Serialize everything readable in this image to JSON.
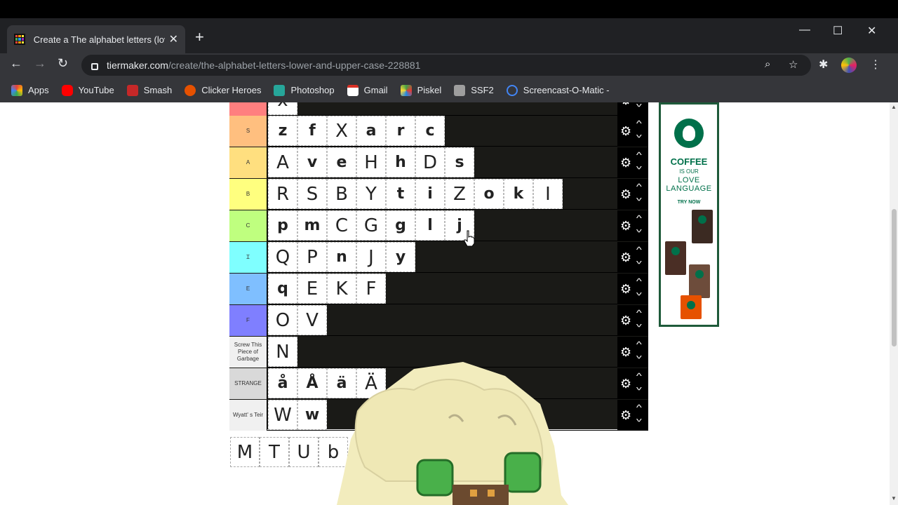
{
  "browser": {
    "tab_title": "Create a The alphabet letters (lov",
    "tab_close": "✕",
    "new_tab": "+",
    "url_host": "tiermaker.com",
    "url_path": "/create/the-alphabet-letters-lower-and-upper-case-228881",
    "window_controls": [
      "—",
      "☐",
      "✕"
    ],
    "nav": {
      "back": "←",
      "forward": "→",
      "reload": "↻"
    },
    "icons": {
      "zoom": "⌕",
      "star": "☆",
      "extensions": "✱",
      "menu": "⋮"
    }
  },
  "bookmarks": [
    {
      "label": "Apps",
      "icon": "apps-grid-icon",
      "color": "#ea4335"
    },
    {
      "label": "YouTube",
      "icon": "youtube-icon",
      "color": "#ff0000"
    },
    {
      "label": "Smash",
      "icon": "smash-icon",
      "color": "#c62828"
    },
    {
      "label": "Clicker Heroes",
      "icon": "clicker-heroes-icon",
      "color": "#e65100"
    },
    {
      "label": "Photoshop",
      "icon": "photoshop-icon",
      "color": "#26a69a"
    },
    {
      "label": "Gmail",
      "icon": "gmail-icon",
      "color": "#d93025"
    },
    {
      "label": "Piskel",
      "icon": "piskel-icon",
      "color": "#43a047"
    },
    {
      "label": "SSF2",
      "icon": "ssf2-icon",
      "color": "#9e9e9e"
    },
    {
      "label": "Screencast-O-Matic -",
      "icon": "screencast-icon",
      "color": "#4285f4"
    }
  ],
  "tiers": [
    {
      "label": "",
      "color": "#ff7f7f",
      "items": [
        "x"
      ]
    },
    {
      "label": "S",
      "color": "#ffbf7f",
      "items": [
        "z",
        "f",
        "X",
        "a",
        "r",
        "c"
      ]
    },
    {
      "label": "A",
      "color": "#ffdf7f",
      "items": [
        "A",
        "v",
        "e",
        "H",
        "h",
        "D",
        "s"
      ]
    },
    {
      "label": "B",
      "color": "#ffff7f",
      "items": [
        "R",
        "S",
        "B",
        "Y",
        "t",
        "i",
        "Z",
        "o",
        "k",
        "I"
      ]
    },
    {
      "label": "C",
      "color": "#bfff7f",
      "items": [
        "p",
        "m",
        "C",
        "G",
        "g",
        "l",
        "j"
      ]
    },
    {
      "label": "Ɪ",
      "color": "#7fffff",
      "items": [
        "Q",
        "P",
        "n",
        "J",
        "y"
      ]
    },
    {
      "label": "E",
      "color": "#7fbfff",
      "items": [
        "q",
        "E",
        "K",
        "F"
      ]
    },
    {
      "label": "F",
      "color": "#7f7fff",
      "items": [
        "O",
        "V"
      ]
    },
    {
      "label": "Screw This Piece of Garbage",
      "color": "#f0f0f0",
      "items": [
        "N"
      ]
    },
    {
      "label": "STRANGE",
      "color": "#d9d9d9",
      "items": [
        "å",
        "Å",
        "ä",
        "Ä"
      ]
    },
    {
      "label": "Wyatt' s Teir",
      "color": "#f0f0f0",
      "items": [
        "W",
        "w"
      ]
    }
  ],
  "pool_items": [
    "M",
    "T",
    "U",
    "b"
  ],
  "controls": {
    "gear": "⚙",
    "up": "^",
    "down": "^"
  },
  "ad": {
    "headline": "COFFEE",
    "sub": "IS OUR",
    "line": "LOVE LANGUAGE",
    "cta": "TRY NOW"
  }
}
